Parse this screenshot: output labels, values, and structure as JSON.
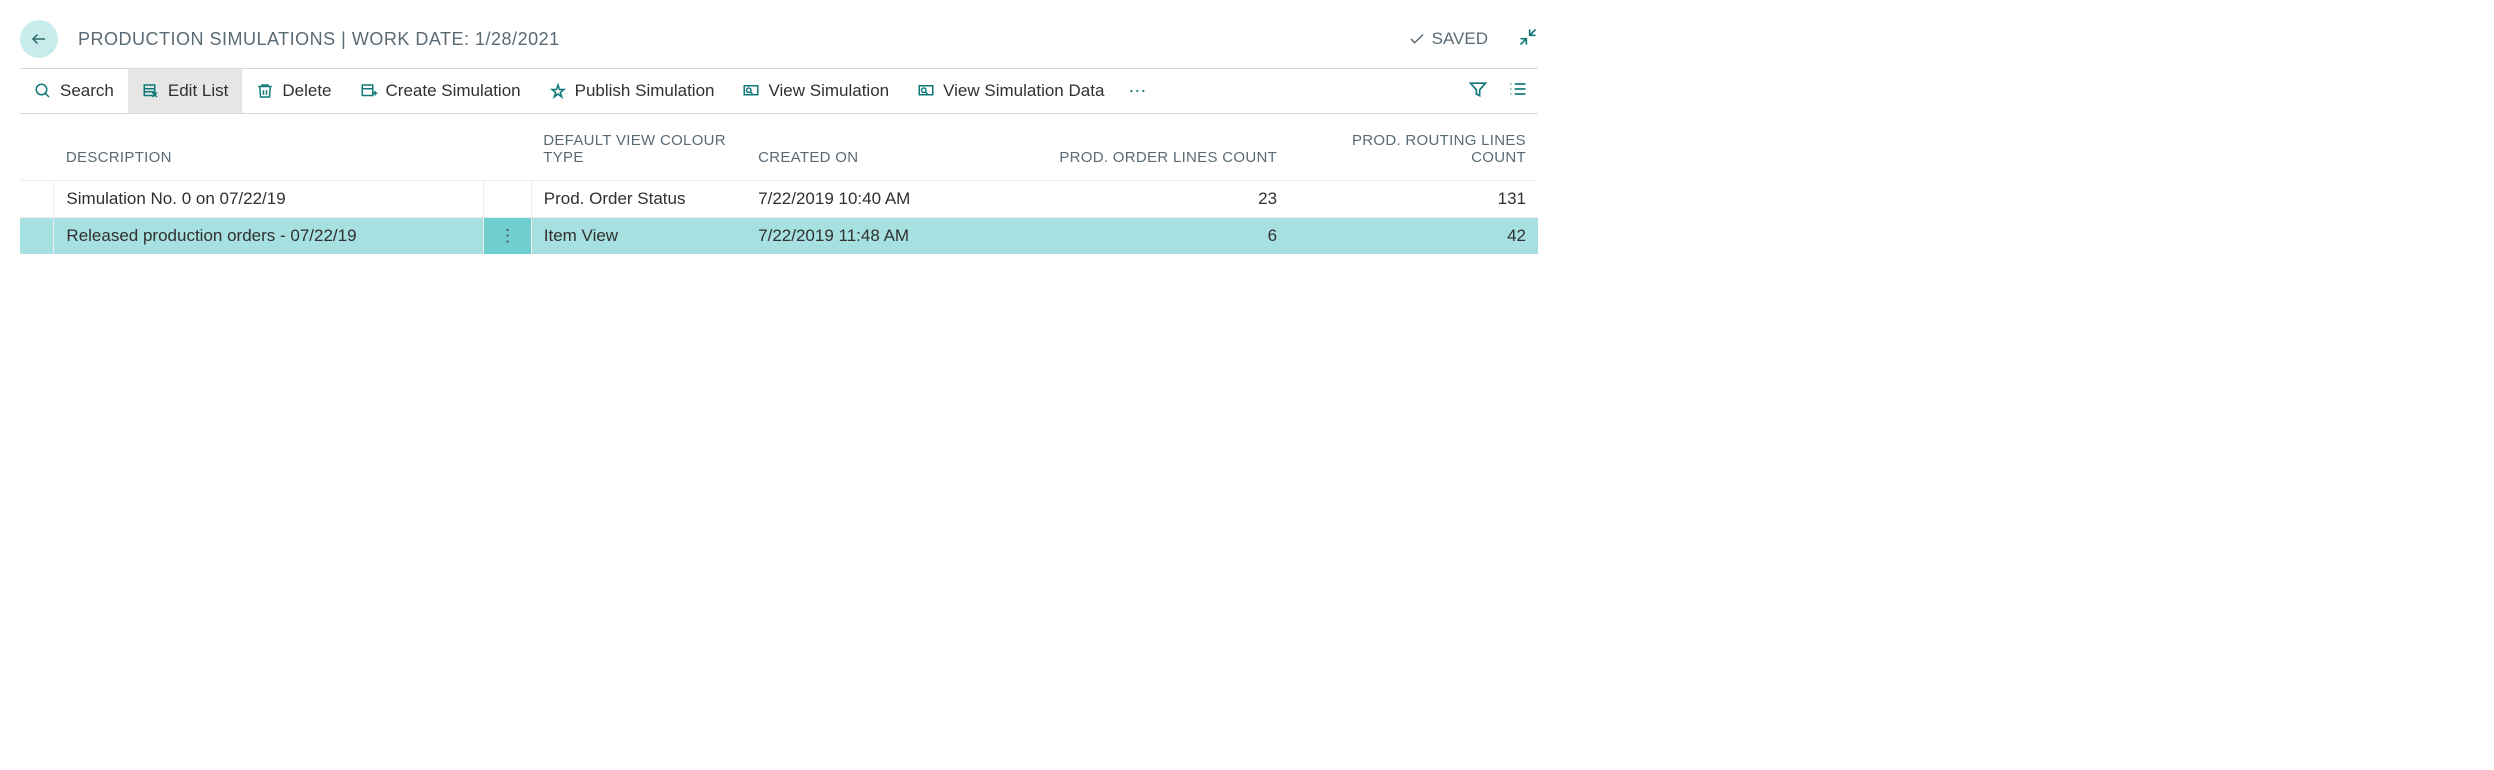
{
  "header": {
    "title": "PRODUCTION SIMULATIONS | WORK DATE: 1/28/2021",
    "saved_label": "SAVED"
  },
  "toolbar": {
    "search": "Search",
    "edit_list": "Edit List",
    "delete": "Delete",
    "create_sim": "Create Simulation",
    "publish_sim": "Publish Simulation",
    "view_sim": "View Simulation",
    "view_sim_data": "View Simulation Data"
  },
  "columns": {
    "description": "DESCRIPTION",
    "colour_type": "DEFAULT VIEW COLOUR TYPE",
    "created_on": "CREATED ON",
    "order_lines": "PROD. ORDER LINES COUNT",
    "routing_lines": "PROD. ROUTING LINES COUNT"
  },
  "rows": [
    {
      "description": "Simulation No. 0 on 07/22/19",
      "colour_type": "Prod. Order Status",
      "created_on": "7/22/2019 10:40 AM",
      "order_lines": "23",
      "routing_lines": "131",
      "selected": false
    },
    {
      "description": "Released production orders - 07/22/19",
      "colour_type": "Item View",
      "created_on": "7/22/2019 11:48 AM",
      "order_lines": "6",
      "routing_lines": "42",
      "selected": true
    }
  ]
}
